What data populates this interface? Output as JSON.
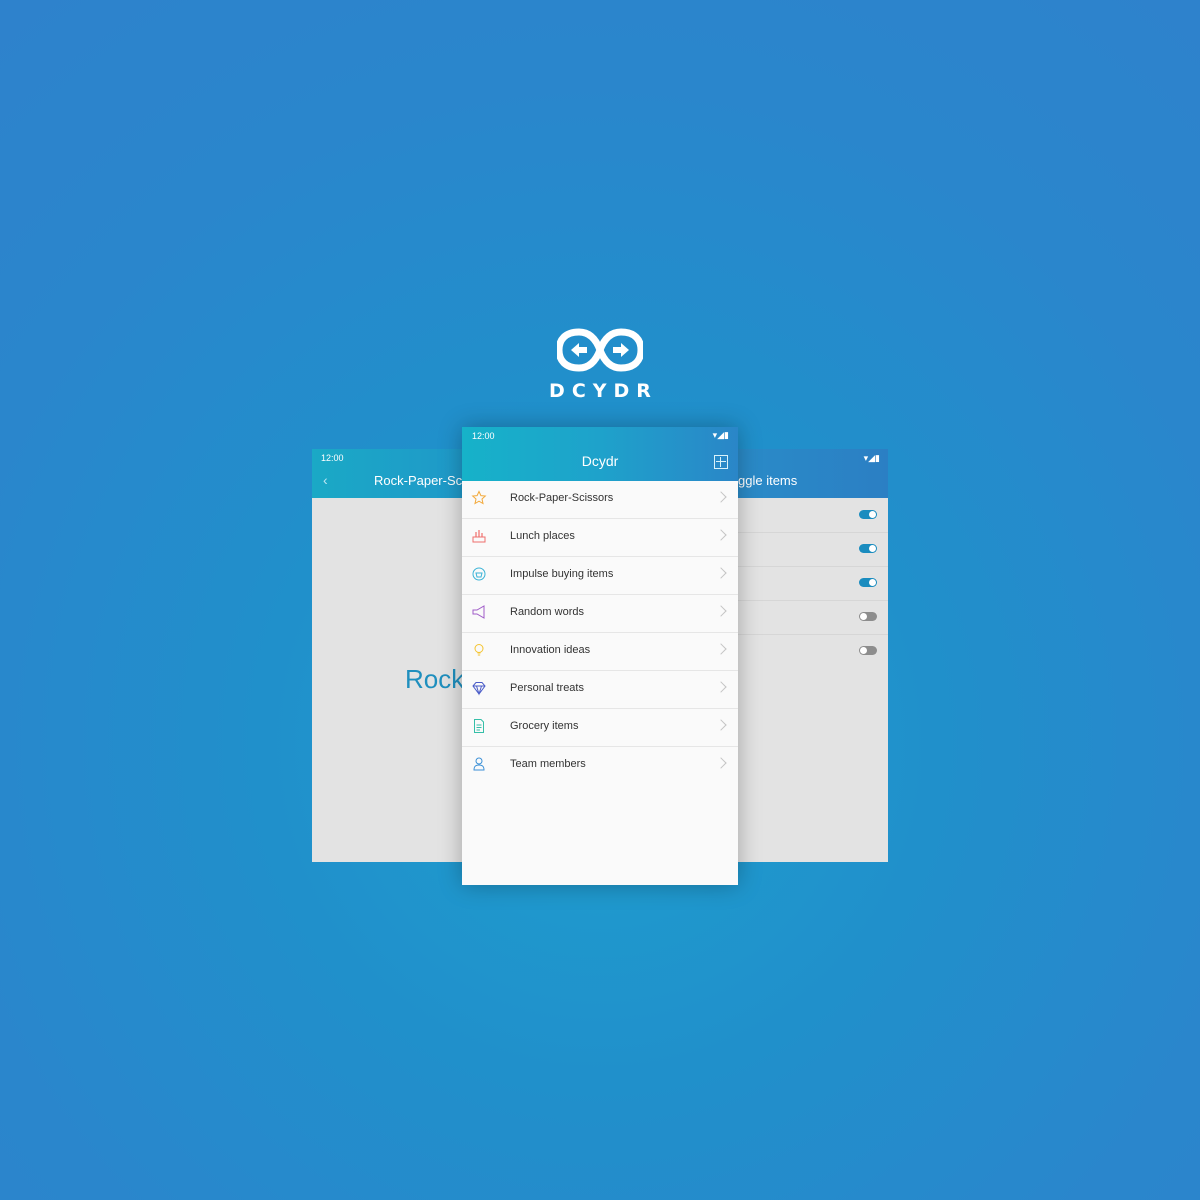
{
  "brand": {
    "name": "DCYDR",
    "logo_icon": "infinity-arrows-icon"
  },
  "left_screen": {
    "status_time": "12:00",
    "title": "Rock-Paper-Sc",
    "big_text": "Rock"
  },
  "right_screen": {
    "title": "ggle items",
    "toggles": [
      {
        "state": "on"
      },
      {
        "state": "on"
      },
      {
        "state": "on"
      },
      {
        "state": "off"
      },
      {
        "state": "off"
      }
    ]
  },
  "main_screen": {
    "status_time": "12:00",
    "title": "Dcydr",
    "add_icon": "add-box-icon",
    "items": [
      {
        "label": "Rock-Paper-Scissors",
        "icon": "star-icon",
        "color": "#f2a93b"
      },
      {
        "label": "Lunch places",
        "icon": "food-icon",
        "color": "#ef6f6c"
      },
      {
        "label": "Impulse buying items",
        "icon": "shopping-icon",
        "color": "#3ab3d6"
      },
      {
        "label": "Random words",
        "icon": "megaphone-icon",
        "color": "#a05cc8"
      },
      {
        "label": "Innovation ideas",
        "icon": "lightbulb-icon",
        "color": "#f4c430"
      },
      {
        "label": "Personal treats",
        "icon": "diamond-icon",
        "color": "#4a5cc8"
      },
      {
        "label": "Grocery items",
        "icon": "document-icon",
        "color": "#35bfa8"
      },
      {
        "label": "Team members",
        "icon": "person-icon",
        "color": "#3a8fd6"
      }
    ]
  }
}
